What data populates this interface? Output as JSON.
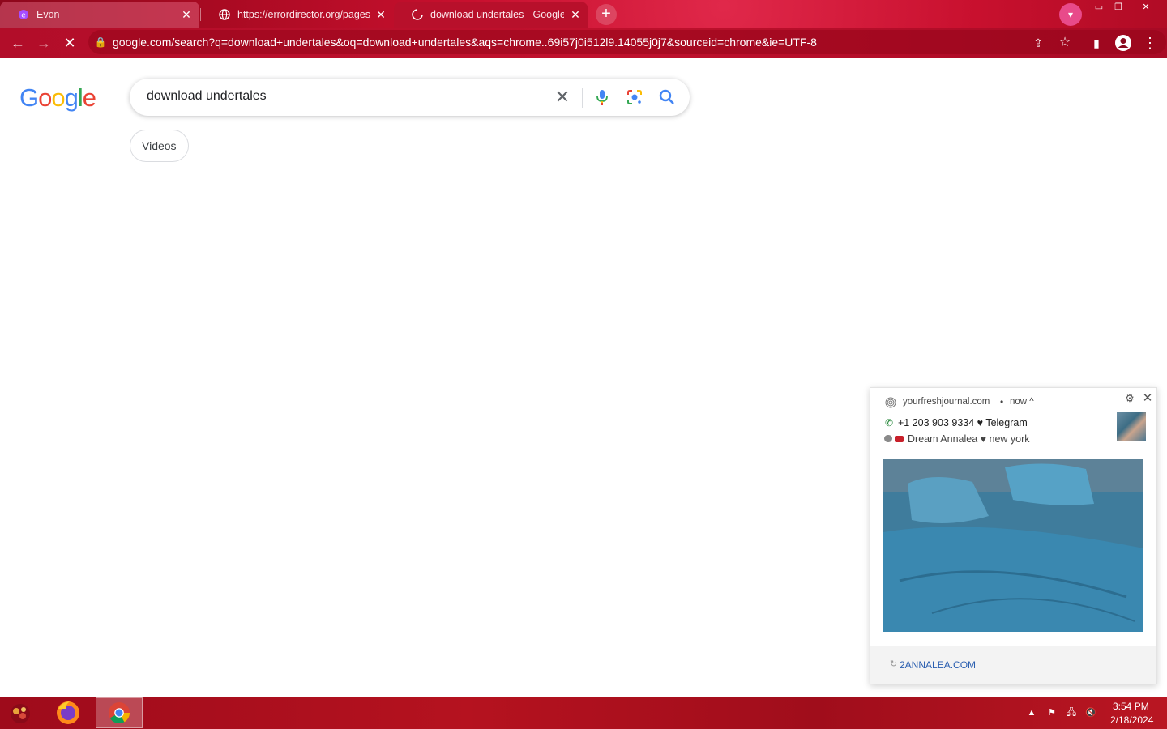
{
  "tabs": [
    {
      "title": "Evon",
      "close": "✕"
    },
    {
      "title": "https://errordirector.org/pages/?",
      "close": "✕"
    },
    {
      "title": "download undertales - Google Se",
      "close": "✕"
    }
  ],
  "toolbar": {
    "url": "google.com/search?q=download+undertales&oq=download+undertales&aqs=chrome..69i57j0i512l9.14055j0j7&sourceid=chrome&ie=UTF-8"
  },
  "google": {
    "logo_letters": [
      "G",
      "o",
      "o",
      "g",
      "l",
      "e"
    ],
    "logo_colors": [
      "#4285f4",
      "#ea4335",
      "#fbbc05",
      "#4285f4",
      "#34a853",
      "#ea4335"
    ],
    "query": "download undertales",
    "chip_videos": "Videos"
  },
  "notification": {
    "site": "yourfreshjournal.com",
    "dot": "•",
    "time": "now ^",
    "line1": "+1 203 903 9334 ♥ Telegram",
    "line2": "Dream Annalea ♥ new york",
    "link": "2ANNALEA.COM"
  },
  "taskbar": {
    "time": "3:54 PM",
    "date": "2/18/2024"
  },
  "colors": {
    "accent_red": "#c8102e",
    "google_blue": "#4285f4"
  },
  "icons": [
    "back-icon",
    "forward-icon",
    "stop-icon",
    "lock-icon",
    "share-icon",
    "star-icon",
    "sidepanel-icon",
    "profile-icon",
    "menu-icon",
    "clear-icon",
    "mic-icon",
    "lens-icon",
    "search-icon"
  ]
}
